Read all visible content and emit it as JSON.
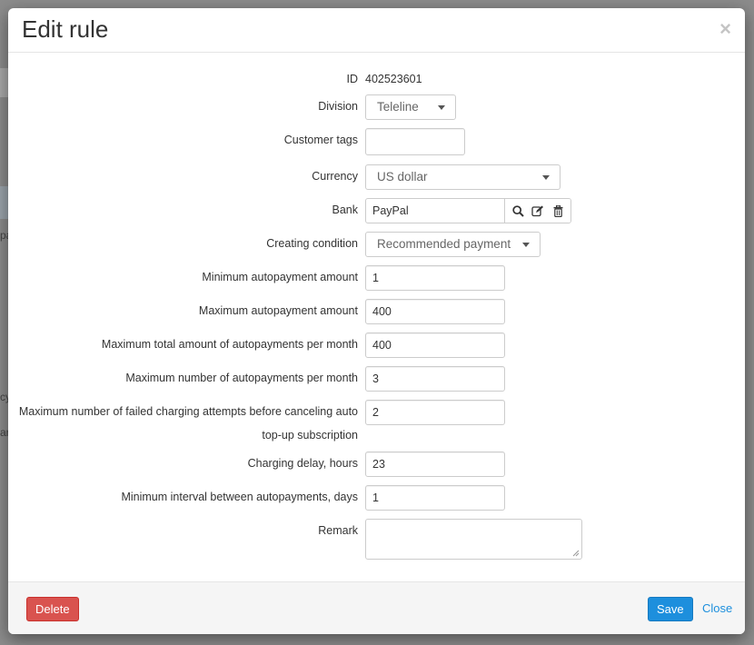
{
  "background": {
    "fragments": [
      "pa",
      "cy",
      "ar"
    ]
  },
  "modal": {
    "title": "Edit rule",
    "close_glyph": "×"
  },
  "form": {
    "id": {
      "label": "ID",
      "value": "402523601"
    },
    "division": {
      "label": "Division",
      "value": "Teleline"
    },
    "customer_tags": {
      "label": "Customer tags",
      "value": ""
    },
    "currency": {
      "label": "Currency",
      "value": "US dollar"
    },
    "bank": {
      "label": "Bank",
      "value": "PayPal",
      "icons": [
        "search-icon",
        "edit-icon",
        "trash-icon"
      ]
    },
    "creating_condition": {
      "label": "Creating condition",
      "value": "Recommended payment"
    },
    "min_amount": {
      "label": "Minimum autopayment amount",
      "value": "1"
    },
    "max_amount": {
      "label": "Maximum autopayment amount",
      "value": "400"
    },
    "max_total_month": {
      "label": "Maximum total amount of autopayments per month",
      "value": "400"
    },
    "max_number_month": {
      "label": "Maximum number of autopayments per month",
      "value": "3"
    },
    "max_failed": {
      "label": "Maximum number of failed charging attempts before canceling auto top-up subscription",
      "value": "2"
    },
    "charging_delay": {
      "label": "Charging delay, hours",
      "value": "23"
    },
    "min_interval": {
      "label": "Minimum interval between autopayments, days",
      "value": "1"
    },
    "remark": {
      "label": "Remark",
      "value": ""
    }
  },
  "footer": {
    "delete_label": "Delete",
    "save_label": "Save",
    "close_label": "Close"
  },
  "colors": {
    "primary": "#1d8fdd",
    "danger": "#d9534f",
    "footer_bg": "#f5f5f5"
  }
}
